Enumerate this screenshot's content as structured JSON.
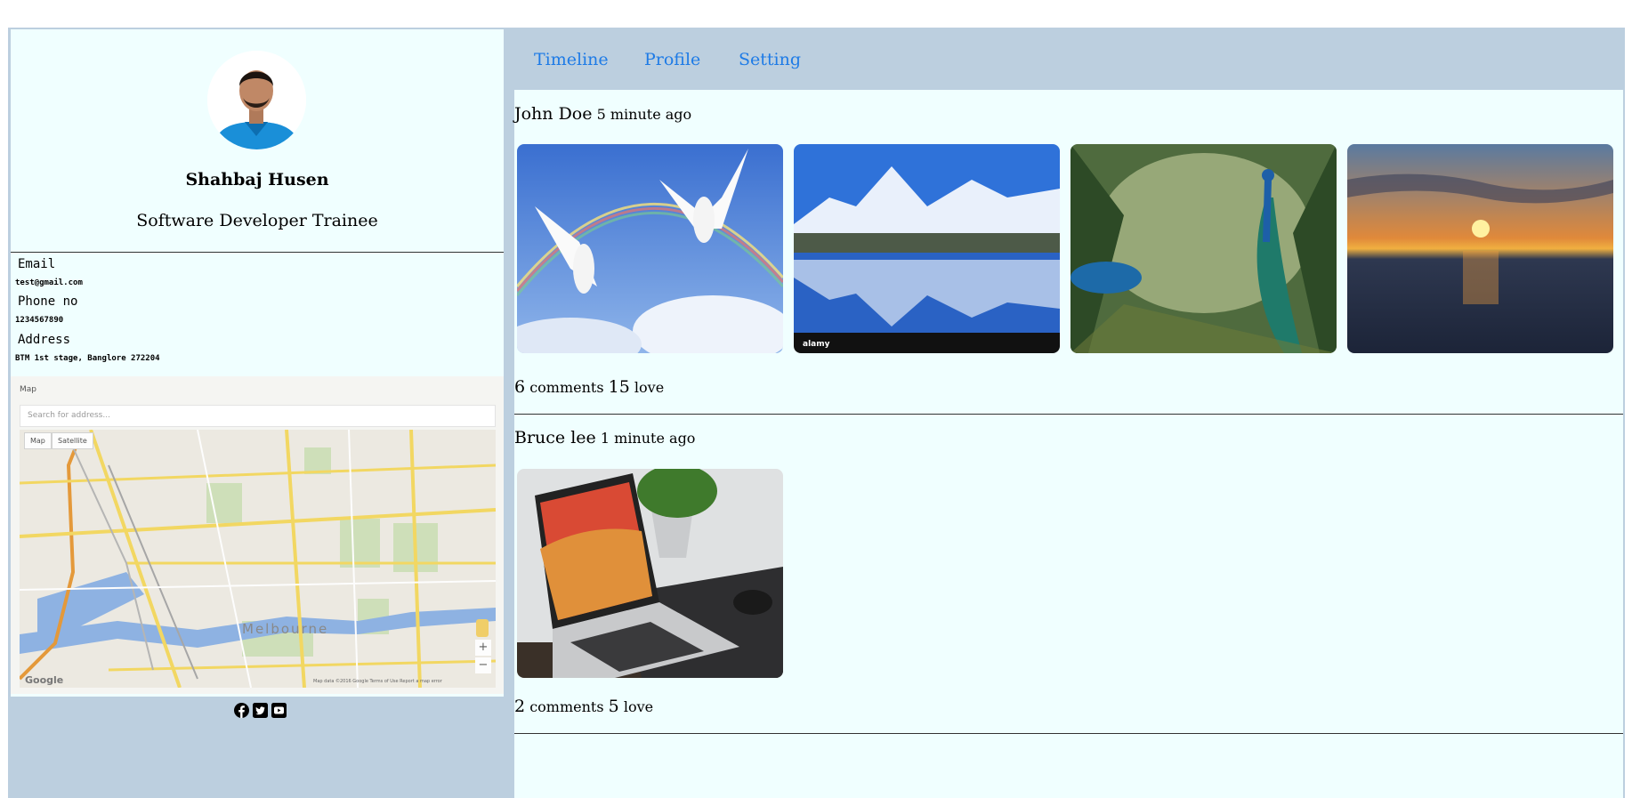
{
  "profile": {
    "name": "Shahbaj Husen",
    "role": "Software Developer Trainee",
    "email_label": "Email",
    "email_value": "test@gmail.com",
    "phone_label": "Phone no",
    "phone_value": "1234567890",
    "address_label": "Address",
    "address_value": "BTM 1st stage, Banglore  272204"
  },
  "map": {
    "title": "Map",
    "search_placeholder": "Search for address...",
    "type_map": "Map",
    "type_satellite": "Satellite",
    "city_label": "Melbourne",
    "zoom_in": "+",
    "zoom_out": "−",
    "logo_text": "Google",
    "footer": "Map data ©2016 Google  Terms of Use  Report a map error"
  },
  "social": {
    "icons": [
      "facebook-icon",
      "twitter-icon",
      "youtube-icon"
    ]
  },
  "nav": {
    "timeline": "Timeline",
    "profile": "Profile",
    "setting": "Setting"
  },
  "posts": [
    {
      "author": "John Doe",
      "time": "5 minute ago",
      "images": [
        "doves-rainbow-image",
        "mountain-lake-image",
        "peacock-jungle-image",
        "sunset-sea-image"
      ],
      "comments_count": "6",
      "comments_label": "comments",
      "love_count": "15",
      "love_label": "love"
    },
    {
      "author": "Bruce lee",
      "time": "1 minute ago",
      "images": [
        "laptop-desk-image"
      ],
      "comments_count": "2",
      "comments_label": "comments",
      "love_count": "5",
      "love_label": "love"
    }
  ],
  "colors": {
    "background": "#bccfdf",
    "panel": "#f0ffff",
    "link": "#1e7be6"
  }
}
